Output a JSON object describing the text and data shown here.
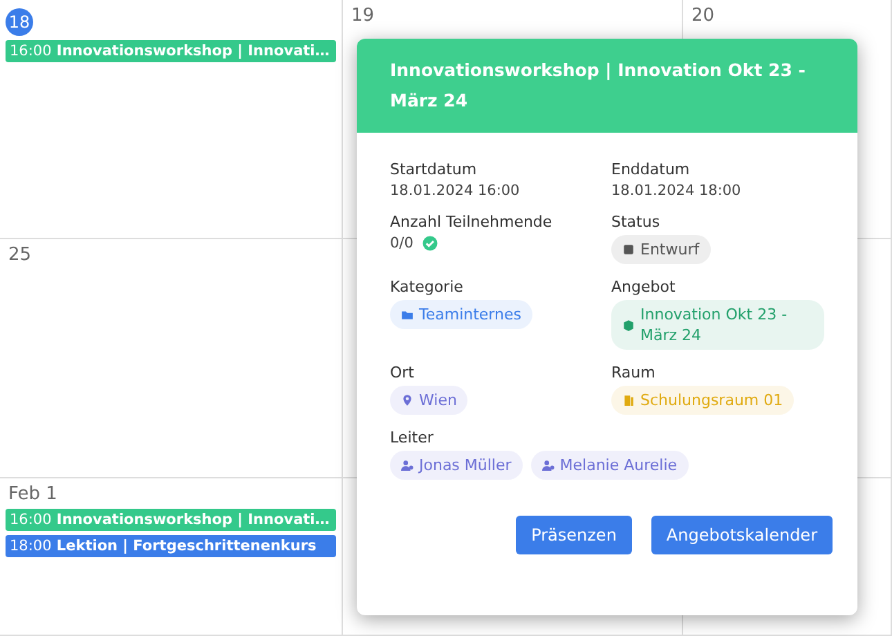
{
  "calendar": {
    "cells": [
      {
        "day": "18",
        "today": true,
        "events": [
          {
            "time": "16:00",
            "title": "Innovationsworkshop | Innovati…",
            "color": "#34c98b"
          }
        ]
      },
      {
        "day": "19",
        "today": false
      },
      {
        "day": "20",
        "today": false
      },
      {
        "day": "25",
        "today": false
      },
      {},
      {},
      {
        "day": "Feb 1",
        "today": false,
        "events": [
          {
            "time": "16:00",
            "title": "Innovationsworkshop | Innovati…",
            "color": "#34c98b"
          },
          {
            "time": "18:00",
            "title": "Lektion | Fortgeschrittenenkurs",
            "color": "#3b7de9"
          }
        ]
      },
      {},
      {}
    ]
  },
  "popup": {
    "title": "Innovationsworkshop | Innovation Okt 23 - März 24",
    "fields": [
      {
        "kind": "text",
        "label": "Startdatum",
        "value": "18.01.2024 16:00"
      },
      {
        "kind": "text",
        "label": "Enddatum",
        "value": "18.01.2024 18:00"
      },
      {
        "kind": "count",
        "label": "Anzahl Teilnehmende",
        "value": "0/0"
      },
      {
        "kind": "status",
        "label": "Status",
        "chips": [
          "Entwurf"
        ],
        "color": "#555555"
      },
      {
        "kind": "category",
        "label": "Kategorie",
        "chips": [
          "Teaminternes"
        ],
        "color": "#3b7de9"
      },
      {
        "kind": "offer",
        "label": "Angebot",
        "chips": [
          "Innovation Okt 23 - März 24"
        ],
        "color": "#22a06b"
      },
      {
        "kind": "location",
        "label": "Ort",
        "chips": [
          "Wien"
        ],
        "color": "#6c6fd6"
      },
      {
        "kind": "room",
        "label": "Raum",
        "chips": [
          "Schulungsraum 01"
        ],
        "color": "#e0aa10"
      },
      {
        "kind": "leader",
        "label": "Leiter",
        "chips": [
          "Jonas Müller",
          "Melanie Aurelie"
        ],
        "color": "#6c6fd6"
      }
    ],
    "buttons": [
      "Präsenzen",
      "Angebotskalender"
    ]
  }
}
